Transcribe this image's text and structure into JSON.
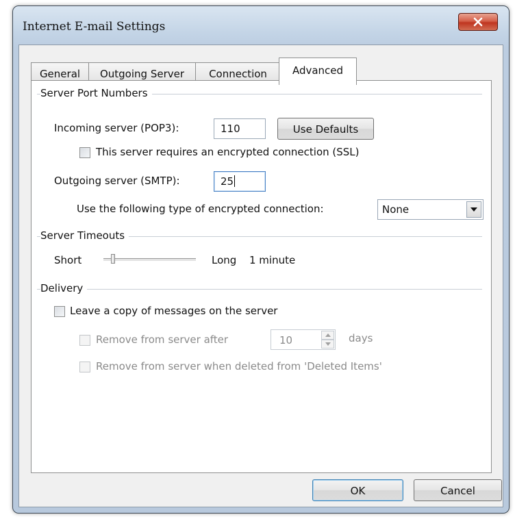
{
  "window": {
    "title": "Internet E-mail Settings",
    "close_label": "x"
  },
  "tabs": [
    {
      "label": "General",
      "active": false
    },
    {
      "label": "Outgoing Server",
      "active": false
    },
    {
      "label": "Connection",
      "active": false
    },
    {
      "label": "Advanced",
      "active": true
    }
  ],
  "server_ports": {
    "group_title": "Server Port Numbers",
    "incoming_label": "Incoming server (POP3):",
    "incoming_value": "110",
    "use_defaults_label": "Use Defaults",
    "ssl_label": "This server requires an encrypted connection (SSL)",
    "ssl_checked": false,
    "outgoing_label": "Outgoing server (SMTP):",
    "outgoing_value": "25",
    "encryption_label": "Use the following type of encrypted connection:",
    "encryption_value": "None"
  },
  "timeouts": {
    "group_title": "Server Timeouts",
    "short_label": "Short",
    "long_label": "Long",
    "value_label": "1 minute",
    "slider_level": 0.1
  },
  "delivery": {
    "group_title": "Delivery",
    "leave_copy_label": "Leave a copy of messages on the server",
    "leave_copy_checked": false,
    "remove_after_label": "Remove from server after",
    "remove_after_value": "10",
    "days_label": "days",
    "remove_deleted_label": "Remove from server when deleted from 'Deleted Items'"
  },
  "footer": {
    "ok_label": "OK",
    "cancel_label": "Cancel"
  }
}
